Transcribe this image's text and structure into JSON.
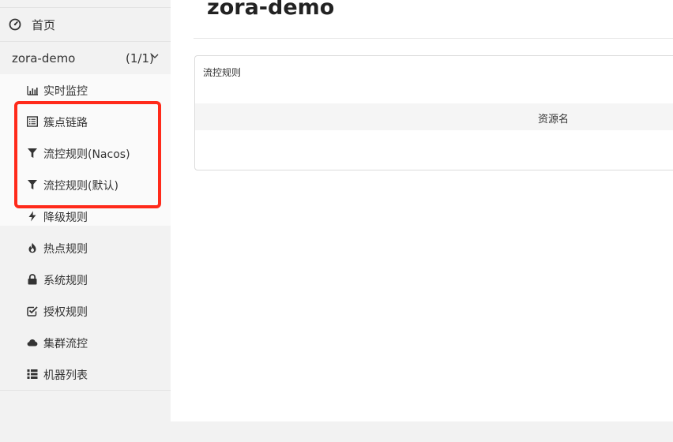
{
  "sidebar": {
    "home_label": "首页",
    "app": {
      "name": "zora-demo",
      "count": "(1/1)"
    },
    "items": [
      {
        "label": "实时监控",
        "icon": "bar-chart-icon"
      },
      {
        "label": "簇点链路",
        "icon": "list-alt-icon"
      },
      {
        "label": "流控规则(Nacos)",
        "icon": "filter-icon"
      },
      {
        "label": "流控规则(默认)",
        "icon": "filter-icon"
      },
      {
        "label": "降级规则",
        "icon": "flash-icon"
      },
      {
        "label": "热点规则",
        "icon": "fire-icon"
      },
      {
        "label": "系统规则",
        "icon": "lock-icon"
      },
      {
        "label": "授权规则",
        "icon": "check-square-icon"
      },
      {
        "label": "集群流控",
        "icon": "cloud-icon"
      },
      {
        "label": "机器列表",
        "icon": "th-list-icon"
      }
    ],
    "highlight_color": "#ff2a1a"
  },
  "main": {
    "title": "zora-demo",
    "panel_title": "流控规则",
    "table_header": "资源名"
  }
}
